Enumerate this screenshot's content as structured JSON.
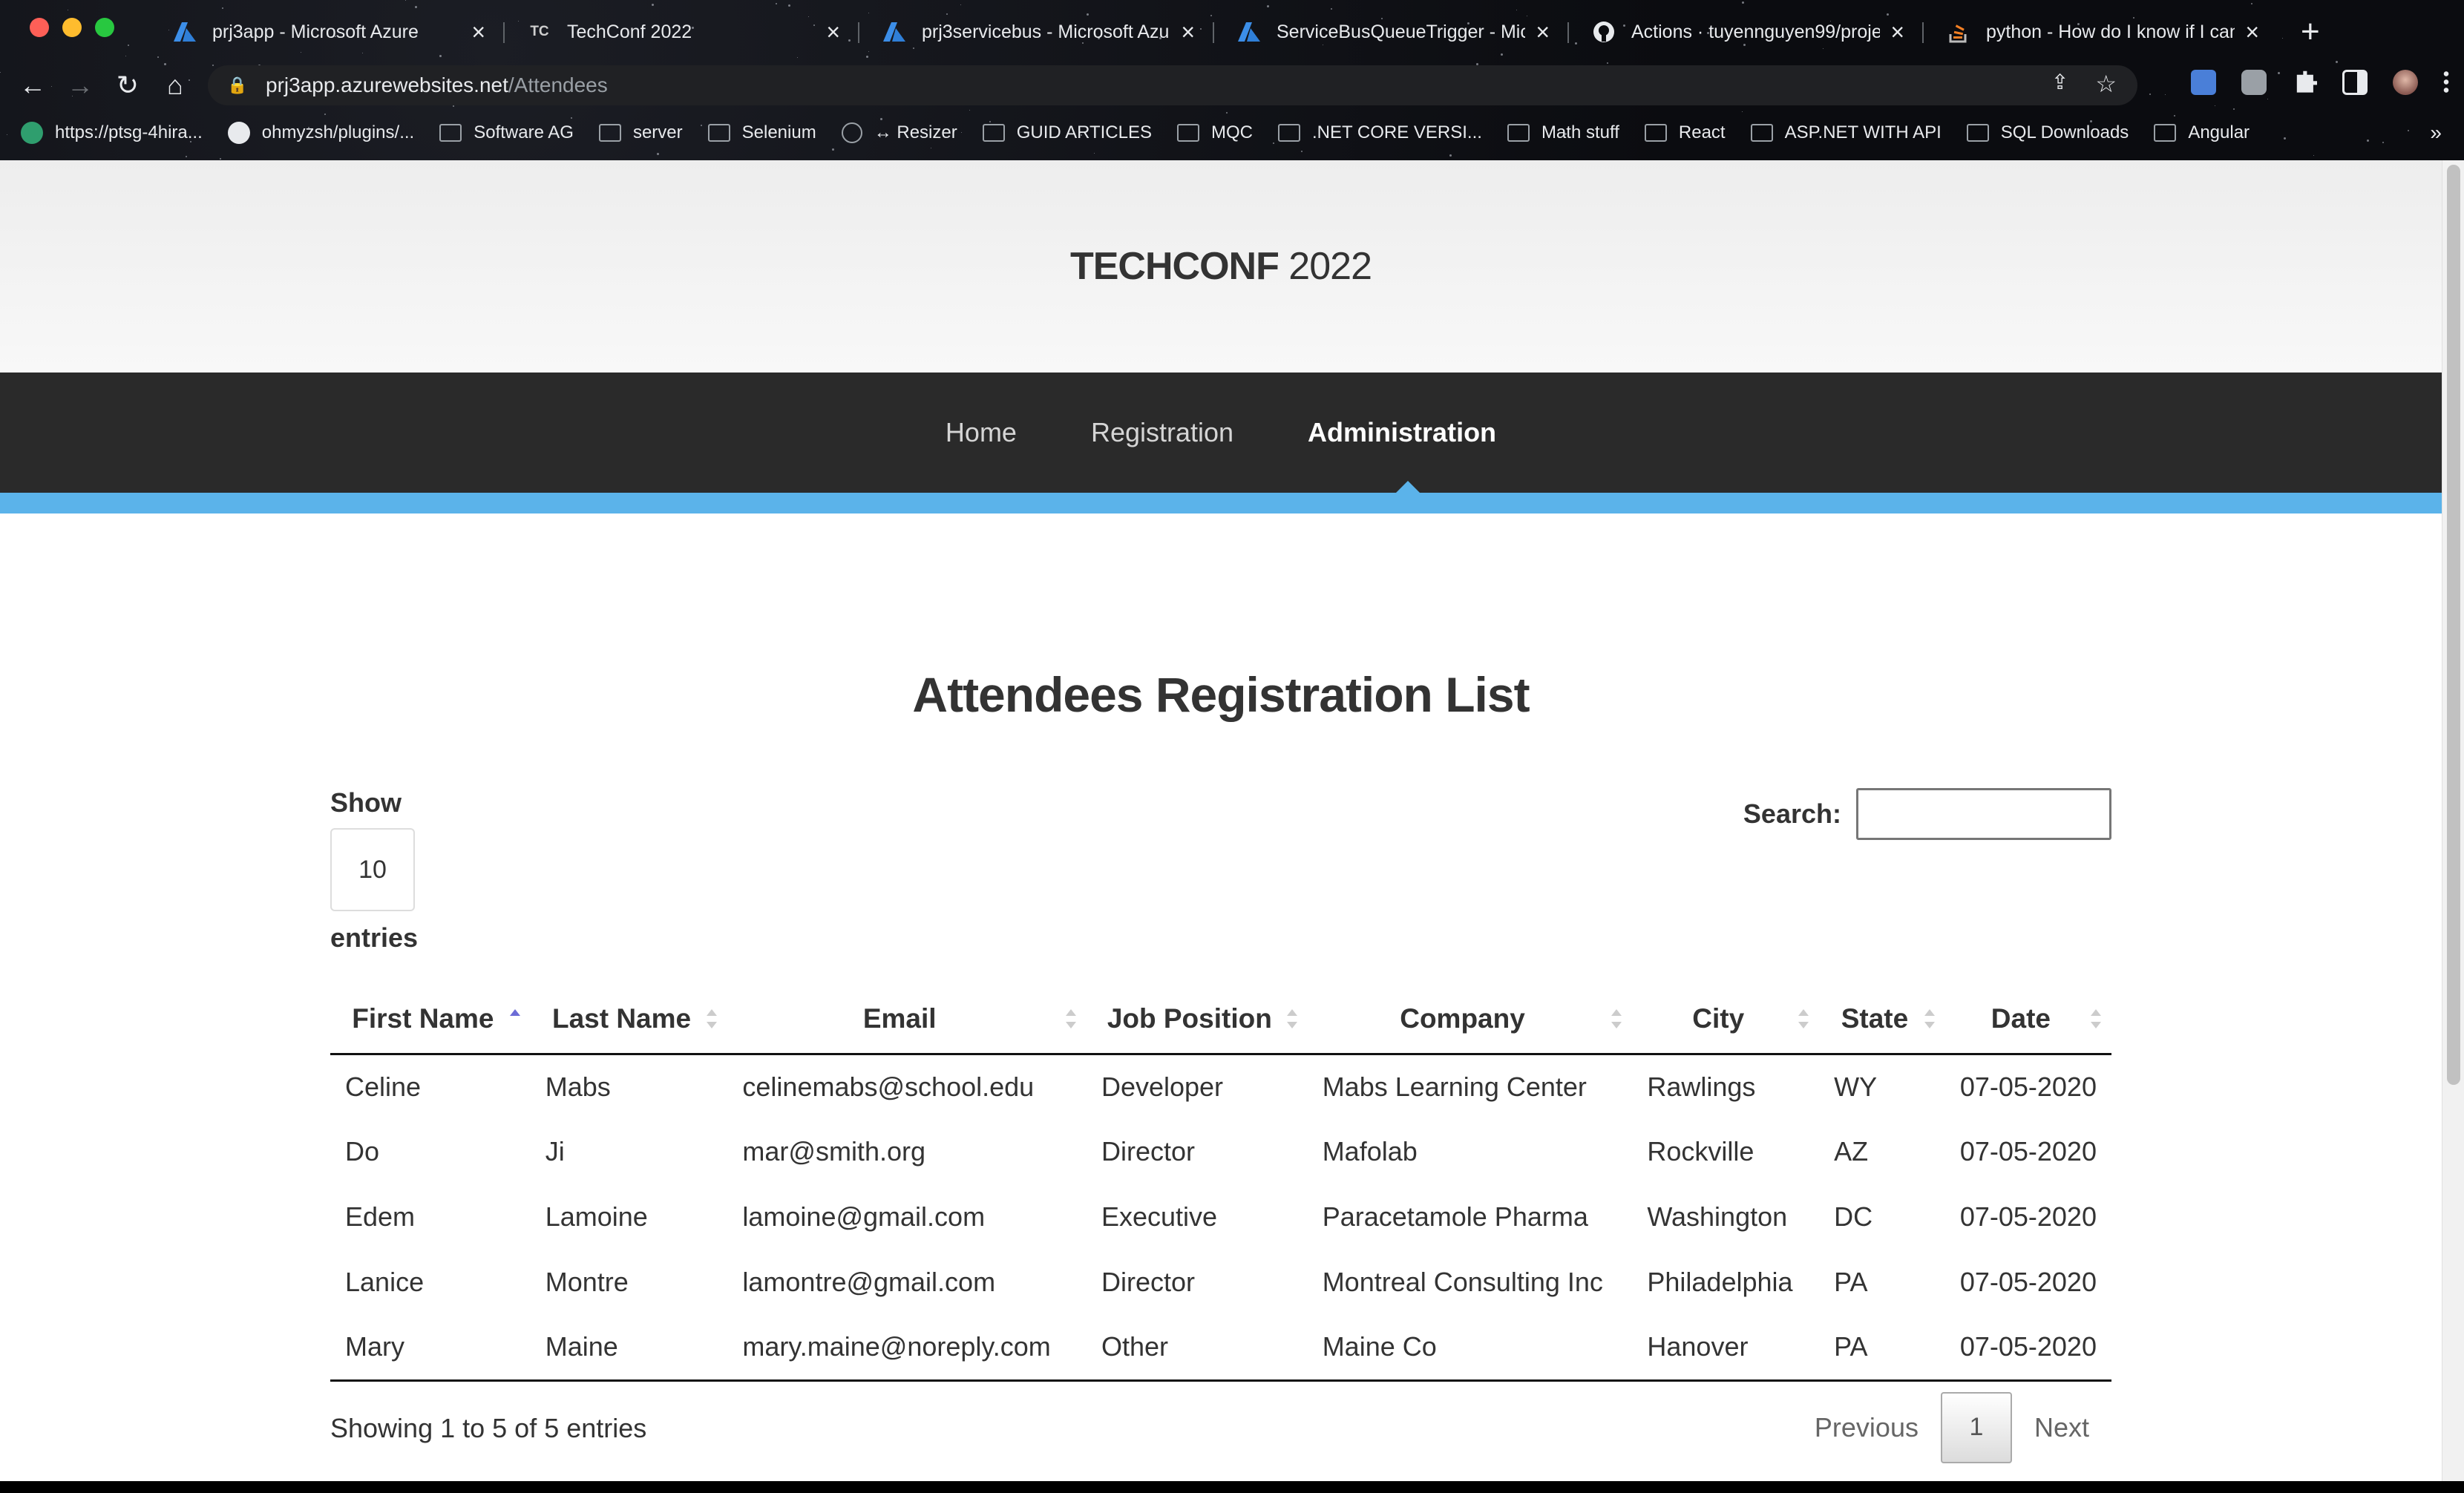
{
  "browser": {
    "tabs": [
      {
        "favicon": "azure-icon",
        "title": "prj3app - Microsoft Azure"
      },
      {
        "favicon": "tc-icon",
        "title": "TechConf 2022",
        "favicon_text": "TC"
      },
      {
        "favicon": "azure-icon",
        "title": "prj3servicebus - Microsoft Azure"
      },
      {
        "favicon": "azure-icon",
        "title": "ServiceBusQueueTrigger - Micr"
      },
      {
        "favicon": "github-icon",
        "title": "Actions · tuyennguyen99/proje"
      },
      {
        "favicon": "stackoverflow-icon",
        "title": "python - How do I know if I can"
      }
    ],
    "url_host": "prj3app.azurewebsites.net",
    "url_path": "/Attendees",
    "bookmarks": [
      {
        "icon": "green-logo-icon",
        "label": "https://ptsg-4hira..."
      },
      {
        "icon": "github-icon",
        "label": "ohmyzsh/plugins/..."
      },
      {
        "icon": "folder-icon",
        "label": "Software AG"
      },
      {
        "icon": "folder-icon",
        "label": "server"
      },
      {
        "icon": "folder-icon",
        "label": "Selenium"
      },
      {
        "icon": "globe-icon",
        "label": "↔ Resizer"
      },
      {
        "icon": "folder-icon",
        "label": "GUID ARTICLES"
      },
      {
        "icon": "folder-icon",
        "label": "MQC"
      },
      {
        "icon": "folder-icon",
        "label": ".NET CORE VERSI..."
      },
      {
        "icon": "folder-icon",
        "label": "Math stuff"
      },
      {
        "icon": "folder-icon",
        "label": "React"
      },
      {
        "icon": "folder-icon",
        "label": "ASP.NET WITH API"
      },
      {
        "icon": "folder-icon",
        "label": "SQL Downloads"
      },
      {
        "icon": "folder-icon",
        "label": "Angular"
      }
    ]
  },
  "site": {
    "brand_bold": "TECHCONF",
    "brand_year": " 2022",
    "nav": [
      {
        "label": "Home",
        "active": false
      },
      {
        "label": "Registration",
        "active": false
      },
      {
        "label": "Administration",
        "active": true
      }
    ]
  },
  "main": {
    "title": "Attendees Registration List",
    "length_label": "Show",
    "length_value": "10",
    "length_after": "entries",
    "search_label": "Search:",
    "search_value": "",
    "columns": [
      "First Name",
      "Last Name",
      "Email",
      "Job Position",
      "Company",
      "City",
      "State",
      "Date"
    ],
    "sorted_column": "First Name",
    "sort_direction": "ascending",
    "rows": [
      [
        "Celine",
        "Mabs",
        "celinemabs@school.edu",
        "Developer",
        "Mabs Learning Center",
        "Rawlings",
        "WY",
        "07-05-2020"
      ],
      [
        "Do",
        "Ji",
        "mar@smith.org",
        "Director",
        "Mafolab",
        "Rockville",
        "AZ",
        "07-05-2020"
      ],
      [
        "Edem",
        "Lamoine",
        "lamoine@gmail.com",
        "Executive",
        "Paracetamole Pharma",
        "Washington",
        "DC",
        "07-05-2020"
      ],
      [
        "Lanice",
        "Montre",
        "lamontre@gmail.com",
        "Director",
        "Montreal Consulting Inc",
        "Philadelphia",
        "PA",
        "07-05-2020"
      ],
      [
        "Mary",
        "Maine",
        "mary.maine@noreply.com",
        "Other",
        "Maine Co",
        "Hanover",
        "PA",
        "07-05-2020"
      ]
    ],
    "info": "Showing 1 to 5 of 5 entries",
    "pagination": {
      "previous": "Previous",
      "current": "1",
      "next": "Next"
    }
  },
  "colors": {
    "nav_bg": "#2a2a2a",
    "accent_blue": "#5bb3ea",
    "sort_active": "#6c6cd6"
  }
}
